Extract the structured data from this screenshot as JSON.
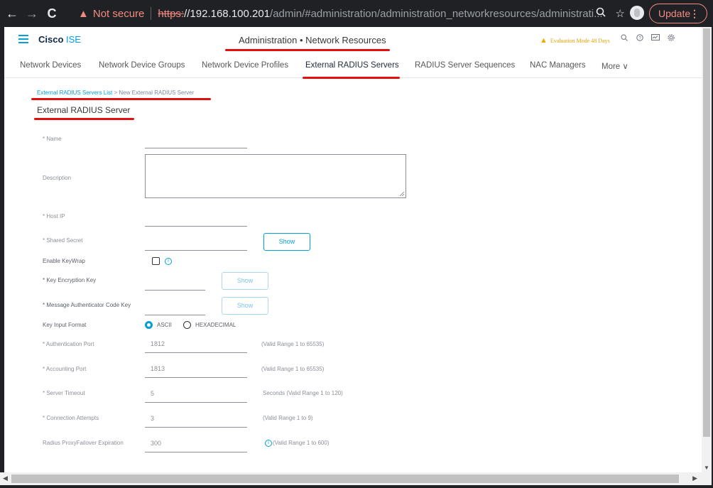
{
  "browser": {
    "back": "←",
    "forward": "→",
    "reload": "C",
    "warning": "▲",
    "not_secure": "Not secure",
    "url_scheme": "https:",
    "url_host": "//192.168.100.201",
    "url_path": "/admin/#administration/administration_networkresources/administrati...",
    "update_label": "Update",
    "update_menu": "⋮"
  },
  "header": {
    "brand_cisco": "Cisco",
    "brand_ise": " ISE",
    "title": "Administration • Network Resources",
    "evaluation": "Evaluation Mode 48 Days"
  },
  "tabs": [
    {
      "label": "Network Devices"
    },
    {
      "label": "Network Device Groups"
    },
    {
      "label": "Network Device Profiles"
    },
    {
      "label": "External RADIUS Servers"
    },
    {
      "label": "RADIUS Server Sequences"
    },
    {
      "label": "NAC Managers"
    },
    {
      "label": "More ∨"
    }
  ],
  "breadcrumb": {
    "list_link": "External RADIUS Servers List",
    "separator": ">",
    "current": "New External RADIUS Server"
  },
  "section_title": "External RADIUS Server",
  "form": {
    "name_label": "* Name",
    "description_label": "Description",
    "host_ip_label": "* Host IP",
    "shared_secret_label": "* Shared Secret",
    "show_label": "Show",
    "enable_keywrap_label": "Enable KeyWrap",
    "key_encryption_label": "*  Key Encryption Key",
    "mac_key_label": "*  Message Authenticator Code Key",
    "key_input_format_label": "Key Input Format",
    "key_input_options": [
      "ASCII",
      "HEXADECIMAL"
    ],
    "key_input_selected": "ASCII",
    "auth_port_label": "* Authentication Port",
    "auth_port_value": "1812",
    "auth_port_hint": "(Valid Range 1 to 65535)",
    "acct_port_label": "* Accounting Port",
    "acct_port_value": "1813",
    "acct_port_hint": "(Valid Range 1 to 65535)",
    "timeout_label": "* Server Timeout",
    "timeout_value": "5",
    "timeout_hint": "Seconds (Valid Range 1 to 120)",
    "conn_attempts_label": "* Connection Attempts",
    "conn_attempts_value": "3",
    "conn_attempts_hint": "(Valid Range 1 to 9)",
    "proxy_label": "Radius ProxyFailover Expiration",
    "proxy_value": "300",
    "proxy_hint": "(Valid Range 1 to 600)"
  },
  "colors": {
    "accent": "#049fd9",
    "annotation_red": "#e01010",
    "warning": "#f28b82"
  }
}
